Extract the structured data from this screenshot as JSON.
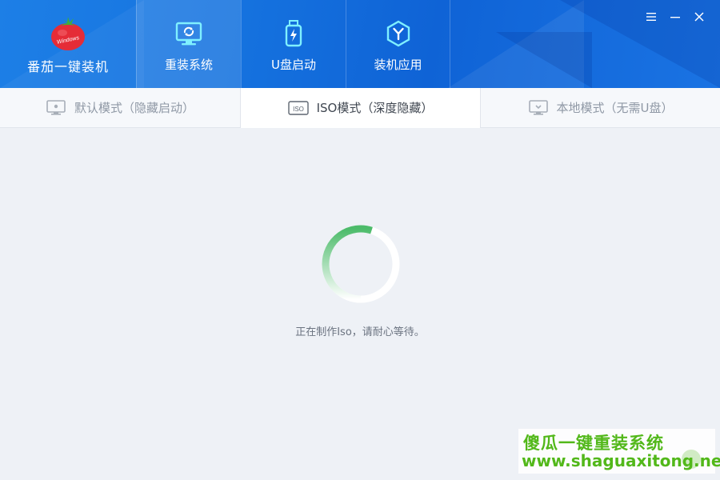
{
  "brand": {
    "name": "番茄一键装机",
    "logo_text": "Windows"
  },
  "nav": [
    {
      "label": "重装系统",
      "icon": "monitor-refresh-icon"
    },
    {
      "label": "U盘启动",
      "icon": "usb-drive-icon"
    },
    {
      "label": "装机应用",
      "icon": "app-hex-icon"
    }
  ],
  "window_controls": [
    "menu-icon",
    "minimize-icon",
    "close-icon"
  ],
  "tabs": [
    {
      "label": "默认模式（隐藏启动）",
      "icon": "monitor-icon",
      "active": false
    },
    {
      "label": "ISO模式（深度隐藏）",
      "icon_text": "ISO",
      "active": true
    },
    {
      "label": "本地模式（无需U盘）",
      "icon": "monitor-download-icon",
      "active": false
    }
  ],
  "status": {
    "text": "正在制作Iso，请耐心等待。"
  },
  "watermark": {
    "title": "傻瓜一键重装系统",
    "url": "www.shaguaxitong.net"
  },
  "colors": {
    "header_blue": "#1674e0",
    "spinner_green": "#4cbb6a",
    "watermark_green": "#52b81a"
  }
}
